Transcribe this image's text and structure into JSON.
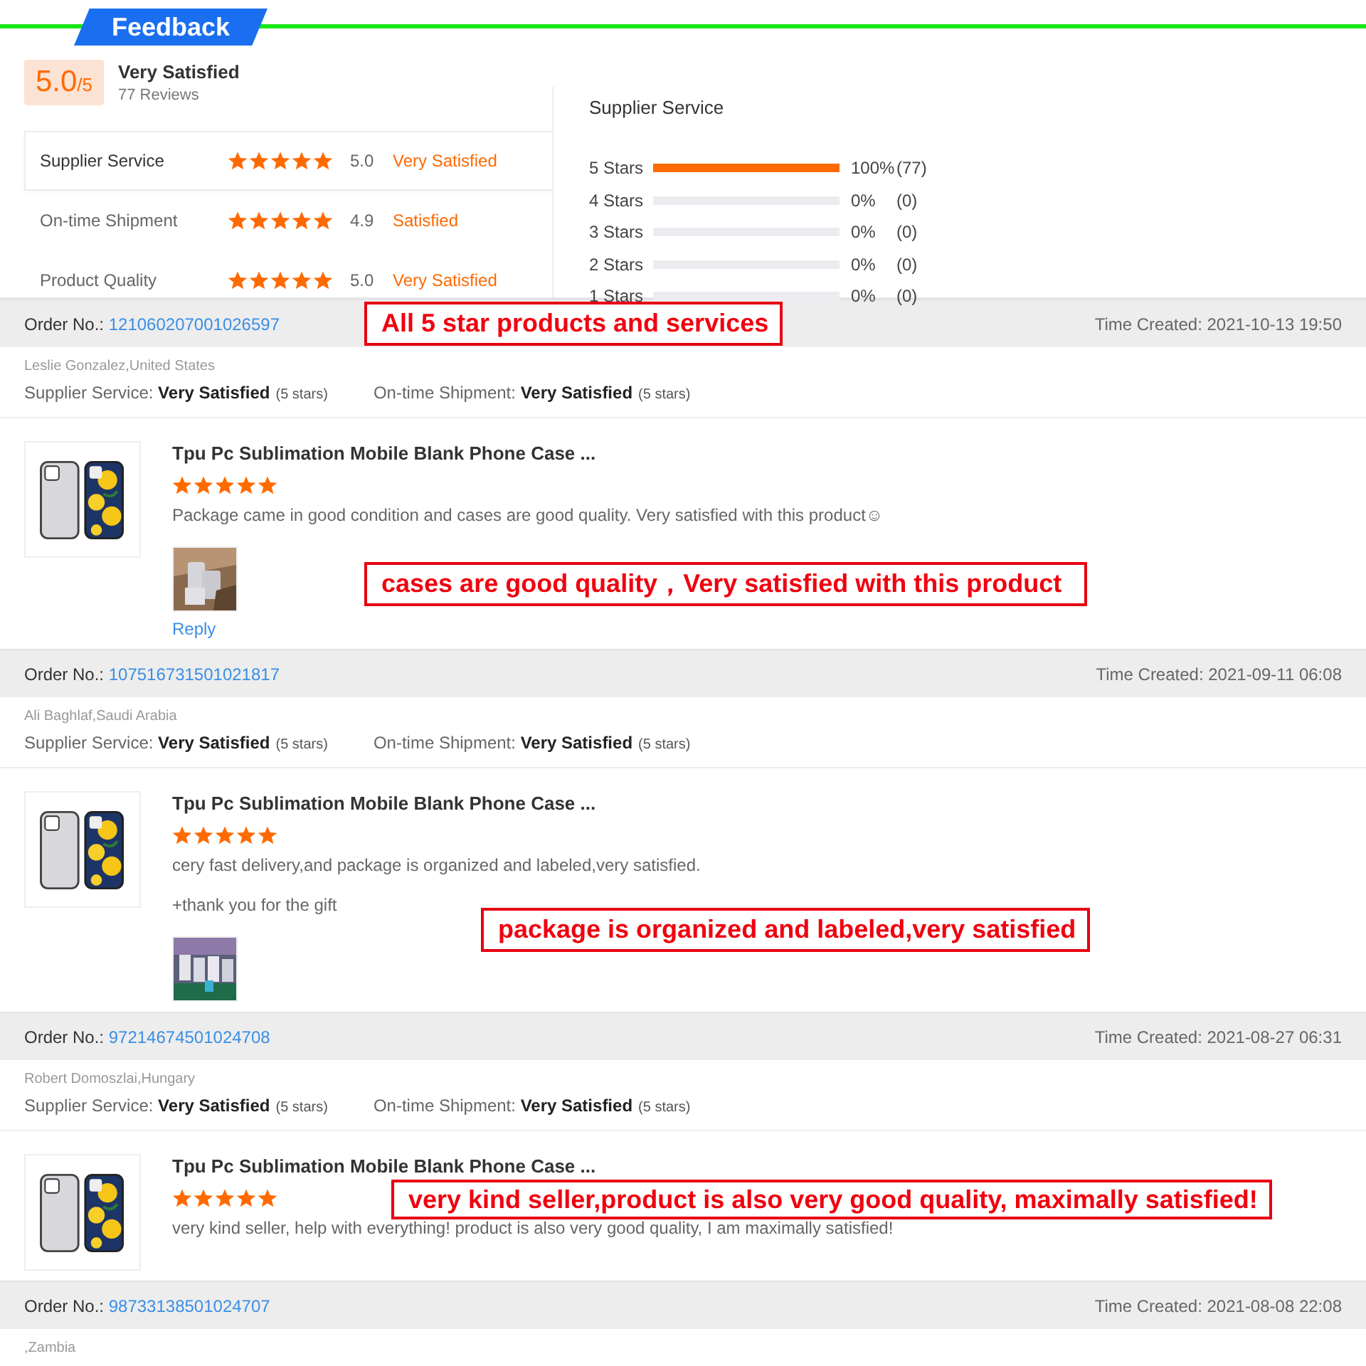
{
  "header": {
    "title": "Feedback"
  },
  "summary": {
    "score": "5.0",
    "score_max": "/5",
    "verdict": "Very Satisfied",
    "reviews": "77 Reviews",
    "ratings": [
      {
        "label": "Supplier Service",
        "stars": 5,
        "value": "5.0",
        "verdict": "Very Satisfied",
        "selected": true
      },
      {
        "label": "On-time Shipment",
        "stars": 5,
        "value": "4.9",
        "verdict": "Satisfied",
        "selected": false
      },
      {
        "label": "Product Quality",
        "stars": 5,
        "value": "5.0",
        "verdict": "Very Satisfied",
        "selected": false
      }
    ],
    "breakdown_title": "Supplier Service",
    "breakdown": [
      {
        "label": "5 Stars",
        "level": 1,
        "percent": "100%",
        "count": "(77)"
      },
      {
        "label": "4 Stars",
        "level": 0,
        "percent": "0%",
        "count": "(0)"
      },
      {
        "label": "3 Stars",
        "level": 0,
        "percent": "0%",
        "count": "(0)"
      },
      {
        "label": "2 Stars",
        "level": 0,
        "percent": "0%",
        "count": "(0)"
      },
      {
        "label": "1 Stars",
        "level": 0,
        "percent": "0%",
        "count": "(0)"
      }
    ]
  },
  "reviews": [
    {
      "order_label": "Order No.:",
      "order_no": "121060207001026597",
      "time": "Time Created: 2021-10-13 19:50",
      "reviewer": "Leslie Gonzalez,United States",
      "ratings": [
        {
          "label": "Supplier Service:",
          "verdict": "Very Satisfied",
          "stars_text": "(5 stars)"
        },
        {
          "label": "On-time Shipment:",
          "verdict": "Very Satisfied",
          "stars_text": "(5 stars)"
        }
      ],
      "product": {
        "title": "Tpu Pc Sublimation Mobile Blank Phone Case ...",
        "stars": 5,
        "comment": [
          "Package came in good condition and cases are good quality. Very satisfied with this product☺"
        ],
        "photos": [
          {
            "kind": "picture"
          }
        ],
        "reply": "Reply"
      }
    },
    {
      "order_label": "Order No.:",
      "order_no": "107516731501021817",
      "time": "Time Created: 2021-09-11 06:08",
      "reviewer": "Ali Baghlaf,Saudi Arabia",
      "ratings": [
        {
          "label": "Supplier Service:",
          "verdict": "Very Satisfied",
          "stars_text": "(5 stars)"
        },
        {
          "label": "On-time Shipment:",
          "verdict": "Very Satisfied",
          "stars_text": "(5 stars)"
        }
      ],
      "product": {
        "title": "Tpu Pc Sublimation Mobile Blank Phone Case ...",
        "stars": 5,
        "comment": [
          "cery fast delivery,and package is organized and labeled,very satisfied.",
          "+thank you for the gift"
        ],
        "photos": [
          {
            "kind": "picture"
          }
        ]
      }
    },
    {
      "order_label": "Order No.:",
      "order_no": "97214674501024708",
      "time": "Time Created: 2021-08-27 06:31",
      "reviewer": "Robert Domoszlai,Hungary",
      "ratings": [
        {
          "label": "Supplier Service:",
          "verdict": "Very Satisfied",
          "stars_text": "(5 stars)"
        },
        {
          "label": "On-time Shipment:",
          "verdict": "Very Satisfied",
          "stars_text": "(5 stars)"
        }
      ],
      "product": {
        "title": "Tpu Pc Sublimation Mobile Blank Phone Case ...",
        "stars": 5,
        "comment": [
          "very kind seller, help with everything!  product is also very good quality, I am maximally satisfied!"
        ]
      }
    },
    {
      "order_label": "Order No.:",
      "order_no": "98733138501024707",
      "time": "Time Created: 2021-08-08 22:08",
      "reviewer": ",Zambia"
    }
  ],
  "annotations": [
    "All 5 star products and services",
    "cases are good quality，Very satisfied with this product",
    "package is organized and labeled,very satisfied",
    "very kind seller,product is also very good quality, maximally satisfied!"
  ]
}
